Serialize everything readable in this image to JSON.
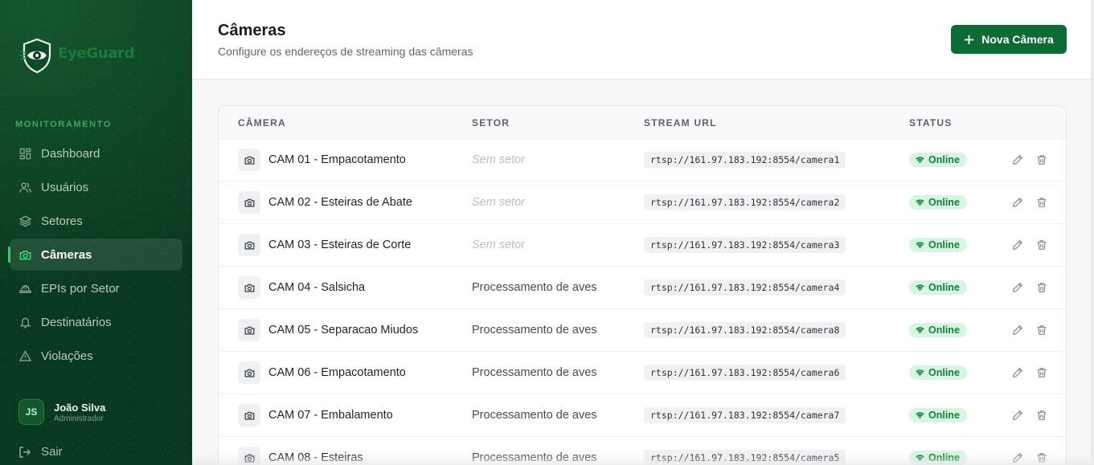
{
  "brand": {
    "name": "EyeGuard"
  },
  "sidebar": {
    "section_label": "MONITORAMENTO",
    "items": [
      {
        "label": "Dashboard",
        "icon": "grid-icon",
        "active": false
      },
      {
        "label": "Usuários",
        "icon": "users-icon",
        "active": false
      },
      {
        "label": "Setores",
        "icon": "layers-icon",
        "active": false
      },
      {
        "label": "Câmeras",
        "icon": "camera-icon",
        "active": true
      },
      {
        "label": "EPIs por Setor",
        "icon": "hardhat-icon",
        "active": false
      },
      {
        "label": "Destinatários",
        "icon": "bell-icon",
        "active": false
      },
      {
        "label": "Violações",
        "icon": "warning-icon",
        "active": false
      }
    ],
    "user": {
      "initials": "JS",
      "name": "João Silva",
      "role": "Administrador"
    },
    "logout_label": "Sair"
  },
  "header": {
    "title": "Câmeras",
    "subtitle": "Configure os endereços de streaming das câmeras",
    "new_button_label": "Nova Câmera"
  },
  "table": {
    "columns": [
      "CÂMERA",
      "SETOR",
      "STREAM URL",
      "STATUS"
    ],
    "rows": [
      {
        "name": "CAM 01 - Empacotamento",
        "sector": "Sem setor",
        "sector_empty": true,
        "url": "rtsp://161.97.183.192:8554/camera1",
        "status": "Online"
      },
      {
        "name": "CAM 02 - Esteiras de Abate",
        "sector": "Sem setor",
        "sector_empty": true,
        "url": "rtsp://161.97.183.192:8554/camera2",
        "status": "Online"
      },
      {
        "name": "CAM 03 - Esteiras de Corte",
        "sector": "Sem setor",
        "sector_empty": true,
        "url": "rtsp://161.97.183.192:8554/camera3",
        "status": "Online"
      },
      {
        "name": "CAM 04 - Salsicha",
        "sector": "Processamento de aves",
        "sector_empty": false,
        "url": "rtsp://161.97.183.192:8554/camera4",
        "status": "Online"
      },
      {
        "name": "CAM 05 - Separacao Miudos",
        "sector": "Processamento de aves",
        "sector_empty": false,
        "url": "rtsp://161.97.183.192:8554/camera8",
        "status": "Online"
      },
      {
        "name": "CAM 06 - Empacotamento",
        "sector": "Processamento de aves",
        "sector_empty": false,
        "url": "rtsp://161.97.183.192:8554/camera6",
        "status": "Online"
      },
      {
        "name": "CAM 07 - Embalamento",
        "sector": "Processamento de aves",
        "sector_empty": false,
        "url": "rtsp://161.97.183.192:8554/camera7",
        "status": "Online"
      },
      {
        "name": "CAM 08 - Esteiras",
        "sector": "Processamento de aves",
        "sector_empty": false,
        "url": "rtsp://161.97.183.192:8554/camera5",
        "status": "Online"
      }
    ]
  },
  "colors": {
    "primary": "#0f6b35",
    "sidebar_bg": "#0a3a1e",
    "online_bg": "#d7f5e1",
    "online_text": "#15803d"
  }
}
